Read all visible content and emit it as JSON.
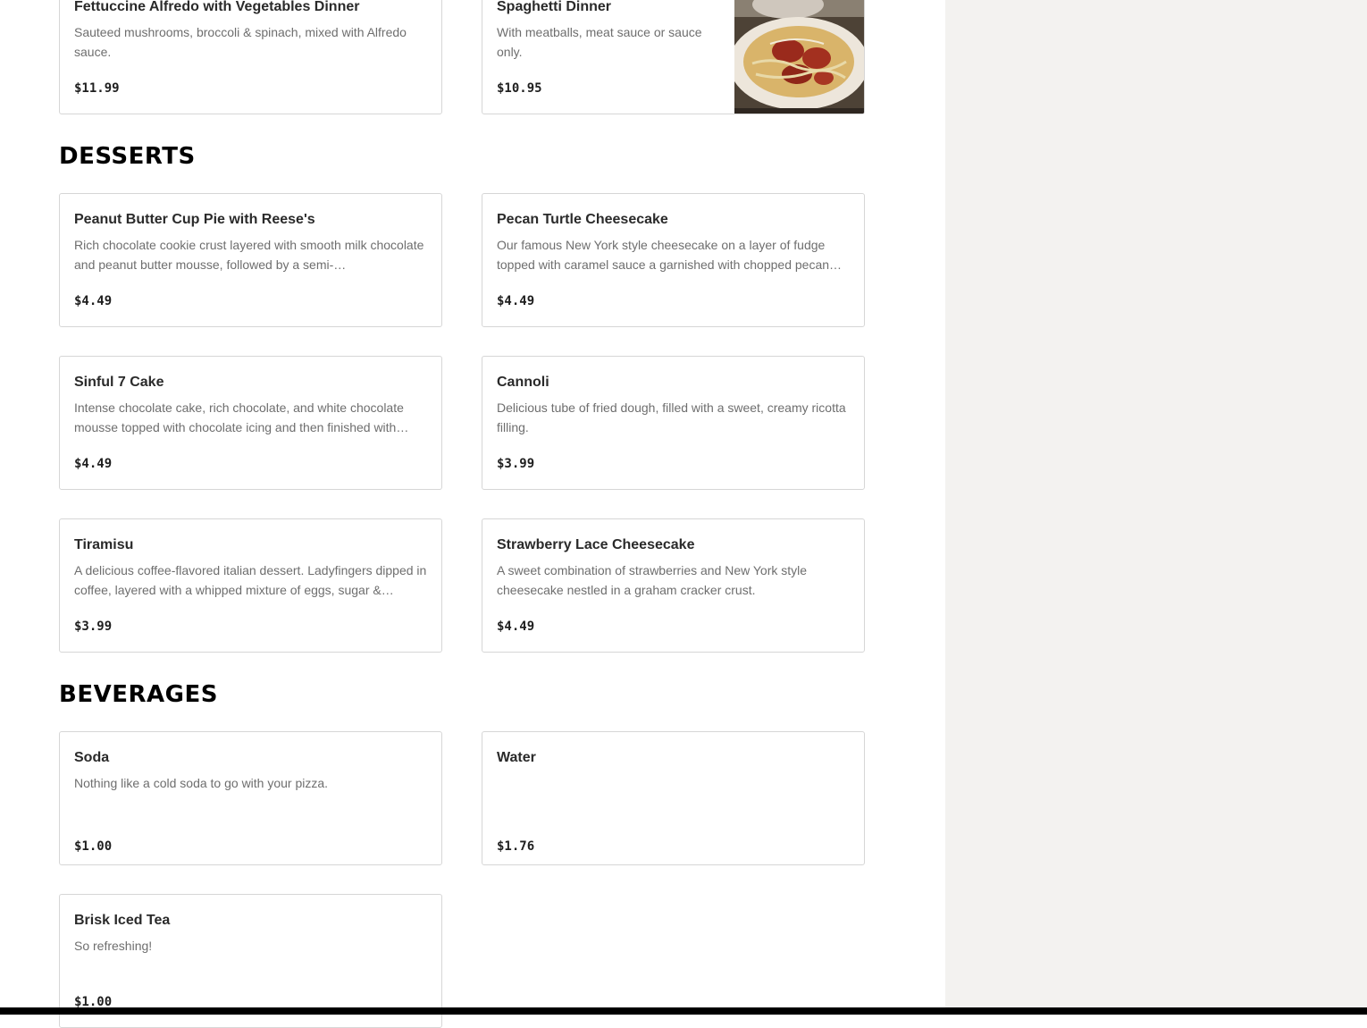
{
  "top_items": [
    {
      "name": "Fettuccine Alfredo with Vegetables Dinner",
      "description": "Sauteed mushrooms, broccoli & spinach, mixed with Alfredo sauce.",
      "price": "$11.99"
    },
    {
      "name": "Spaghetti Dinner",
      "description": "With meatballs, meat sauce or sauce only.",
      "price": "$10.95",
      "photo_icon": "spaghetti-photo"
    }
  ],
  "sections": {
    "desserts": {
      "title": "DESSERTS",
      "items": [
        {
          "name": "Peanut Butter Cup Pie with Reese's",
          "description": "Rich chocolate cookie crust layered with smooth milk chocolate and peanut butter mousse, followed by a semi-…",
          "price": "$4.49"
        },
        {
          "name": "Pecan Turtle Cheesecake",
          "description": "Our famous New York style cheesecake on a layer of fudge topped with caramel sauce a garnished with chopped pecan…",
          "price": "$4.49"
        },
        {
          "name": "Sinful 7 Cake",
          "description": "Intense chocolate cake, rich chocolate, and white chocolate mousse topped with chocolate icing and then finished with…",
          "price": "$4.49"
        },
        {
          "name": "Cannoli",
          "description": "Delicious tube of fried dough, filled with a sweet, creamy ricotta filling.",
          "price": "$3.99"
        },
        {
          "name": "Tiramisu",
          "description": "A delicious coffee-flavored italian dessert. Ladyfingers dipped in coffee, layered with a whipped mixture of eggs, sugar &…",
          "price": "$3.99"
        },
        {
          "name": "Strawberry Lace Cheesecake",
          "description": "A sweet combination of strawberries and New York style cheesecake nestled in a graham cracker crust.",
          "price": "$4.49"
        }
      ]
    },
    "beverages": {
      "title": "BEVERAGES",
      "items": [
        {
          "name": "Soda",
          "description": "Nothing like a cold soda to go with your pizza.",
          "price": "$1.00"
        },
        {
          "name": "Water",
          "description": "",
          "price": "$1.76"
        },
        {
          "name": "Brisk Iced Tea",
          "description": "So refreshing!",
          "price": "$1.00"
        }
      ]
    }
  },
  "colors": {
    "side_panel": "#f3f2f0",
    "card_border": "#d6d6d6",
    "description_text": "#6e6e6e",
    "heading_text": "#000000"
  }
}
